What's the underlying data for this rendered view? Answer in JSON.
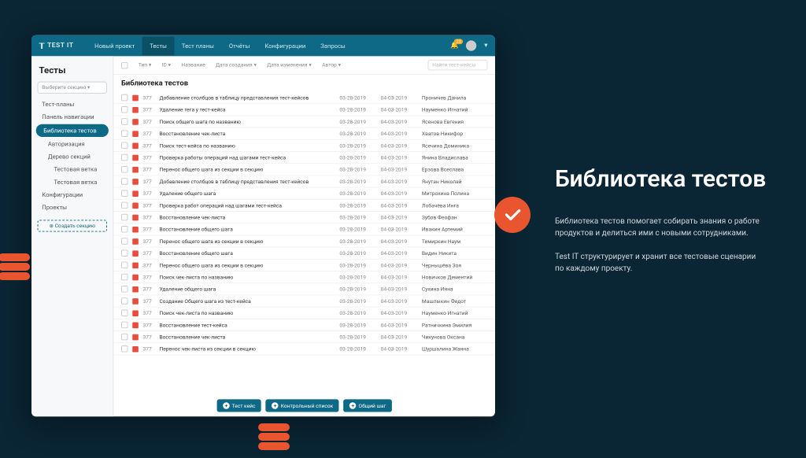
{
  "slide": {
    "heading": "Библиотека тестов",
    "p1": "Библиотека тестов помогает собирать знания о работе продуктов и делиться ими с новыми сотрудниками.",
    "p2": "Test IT структурирует и хранит все тестовые сценарии по каждому проекту."
  },
  "app": {
    "logo": "TEST IT",
    "nav": [
      "Новый проект",
      "Тесты",
      "Тест планы",
      "Отчёты",
      "Конфигурации",
      "Запросы"
    ],
    "nav_active": 1,
    "notif_count": "23",
    "sidebar": {
      "title": "Тесты",
      "select_placeholder": "Выберите секцию",
      "items": [
        {
          "label": "Тест-планы",
          "cls": ""
        },
        {
          "label": "Панель навигации",
          "cls": ""
        },
        {
          "label": "Библиотека тестов",
          "cls": "active"
        },
        {
          "label": "Авторизация",
          "cls": "sub"
        },
        {
          "label": "Дерево секций",
          "cls": "sub"
        },
        {
          "label": "Тестовая ветка",
          "cls": "sub2"
        },
        {
          "label": "Тестовая ветка",
          "cls": "sub2"
        },
        {
          "label": "Конфигурации",
          "cls": ""
        },
        {
          "label": "Проекты",
          "cls": ""
        }
      ],
      "create": "Создать секцию"
    },
    "filters": {
      "type": "Тип",
      "id": "ID",
      "name": "Название",
      "created": "Дата создания",
      "modified": "Дата изменения",
      "author": "Автор",
      "search": "Найти тест-кейсы"
    },
    "section_title": "Библиотека тестов",
    "rows": [
      {
        "id": "377",
        "name": "Добавление столбцов в таблицу представления тест-кейсов",
        "d1": "03-28-2019",
        "d2": "04-03-2019",
        "author": "Проничев Данила"
      },
      {
        "id": "377",
        "name": "Удаление тега у тест-кейса",
        "d1": "03-28-2019",
        "d2": "04-03-2019",
        "author": "Науменко Игнатий"
      },
      {
        "id": "377",
        "name": "Поиск общего шага по названию",
        "d1": "03-28-2019",
        "d2": "04-03-2019",
        "author": "Ясенова Евгения"
      },
      {
        "id": "377",
        "name": "Восстановление чек-листа",
        "d1": "03-28-2019",
        "d2": "04-03-2019",
        "author": "Хватов Никифор"
      },
      {
        "id": "377",
        "name": "Поиск тест-кейса по названию",
        "d1": "03-28-2019",
        "d2": "04-03-2019",
        "author": "Ясечина Доминика"
      },
      {
        "id": "377",
        "name": "Проверка работы операций над шагами тест-кейса",
        "d1": "03-28-2019",
        "d2": "04-03-2019",
        "author": "Янина Владислава"
      },
      {
        "id": "377",
        "name": "Перенос общего шага из секции в секцию",
        "d1": "03-28-2019",
        "d2": "04-03-2019",
        "author": "Ерзова Всеслава"
      },
      {
        "id": "377",
        "name": "Добавление столбцов в таблицу представления тест-кейсов",
        "d1": "03-28-2019",
        "d2": "04-03-2019",
        "author": "Янутан Николай"
      },
      {
        "id": "377",
        "name": "Удаление общего шага",
        "d1": "03-28-2019",
        "d2": "04-03-2019",
        "author": "Митрохина Полина"
      },
      {
        "id": "377",
        "name": "Проверка работ операций над шагами тест-кейса",
        "d1": "03-28-2019",
        "d2": "04-03-2019",
        "author": "Лобачёва Инга"
      },
      {
        "id": "377",
        "name": "Восстановление чек-листа",
        "d1": "03-28-2019",
        "d2": "04-03-2019",
        "author": "Зубов Феофан"
      },
      {
        "id": "377",
        "name": "Восстановление общего шага",
        "d1": "03-28-2019",
        "d2": "04-03-2019",
        "author": "Ивакин Артемий"
      },
      {
        "id": "377",
        "name": "Перенос общего шага из секции в секцию",
        "d1": "03-28-2019",
        "d2": "04-03-2019",
        "author": "Тимиркин Наум"
      },
      {
        "id": "377",
        "name": "Восстановление общего шага",
        "d1": "03-28-2019",
        "d2": "04-03-2019",
        "author": "Видин Никита"
      },
      {
        "id": "377",
        "name": "Перенос общего шага из секции в секцию",
        "d1": "03-28-2019",
        "d2": "04-03-2019",
        "author": "Чернышёва Зоя"
      },
      {
        "id": "377",
        "name": "Поиск чек-листа по названию",
        "d1": "03-28-2019",
        "d2": "04-03-2019",
        "author": "Новичков Дементий"
      },
      {
        "id": "377",
        "name": "Удаление общего шага",
        "d1": "03-28-2019",
        "d2": "04-03-2019",
        "author": "Сухина Инна"
      },
      {
        "id": "377",
        "name": "Создание Общего шага из тест-кейса",
        "d1": "03-28-2019",
        "d2": "04-03-2019",
        "author": "Машлыкин Федот"
      },
      {
        "id": "377",
        "name": "Поиск чек-листа по названию",
        "d1": "03-28-2019",
        "d2": "04-03-2019",
        "author": "Науменко Игнатий"
      },
      {
        "id": "377",
        "name": "Восстановление тест-кейса",
        "d1": "03-28-2019",
        "d2": "04-03-2019",
        "author": "Ратничкина Эмилия"
      },
      {
        "id": "377",
        "name": "Восстановление чек-листа",
        "d1": "03-28-2019",
        "d2": "04-03-2019",
        "author": "Чикунова Оксана"
      },
      {
        "id": "377",
        "name": "Перенос чек-листа из секции в секцию",
        "d1": "03-28-2019",
        "d2": "04-03-2019",
        "author": "Шуршалина Жанна"
      }
    ],
    "actions": {
      "tc": "Тест кейс",
      "cl": "Контрольный список",
      "ss": "Общий шаг"
    }
  }
}
